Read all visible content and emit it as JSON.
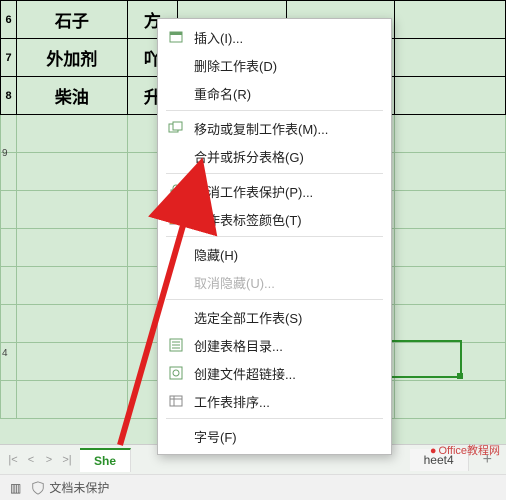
{
  "rows": {
    "r6": {
      "label": "6",
      "c1": "石子",
      "c2": "方"
    },
    "r7": {
      "label": "7",
      "c1": "外加剂",
      "c2": "吖"
    },
    "r8": {
      "label": "8",
      "c1": "柴油",
      "c2": "升"
    },
    "r9": {
      "label": "9"
    },
    "r14": {
      "label": "4"
    }
  },
  "menu": {
    "insert": "插入(I)...",
    "delete_sheet": "删除工作表(D)",
    "rename": "重命名(R)",
    "move_copy": "移动或复制工作表(M)...",
    "merge_split": "合并或拆分表格(G)",
    "unprotect": "撤消工作表保护(P)...",
    "tab_color": "工作表标签颜色(T)",
    "hide": "隐藏(H)",
    "unhide": "取消隐藏(U)...",
    "select_all": "选定全部工作表(S)",
    "create_toc": "创建表格目录...",
    "create_links": "创建文件超链接...",
    "sort_sheets": "工作表排序...",
    "font_size": "字号(F)"
  },
  "tabs": {
    "active": "She",
    "t4": "heet4",
    "add": "+"
  },
  "status": {
    "protect": "文档未保护"
  },
  "watermark": "Office教程网"
}
